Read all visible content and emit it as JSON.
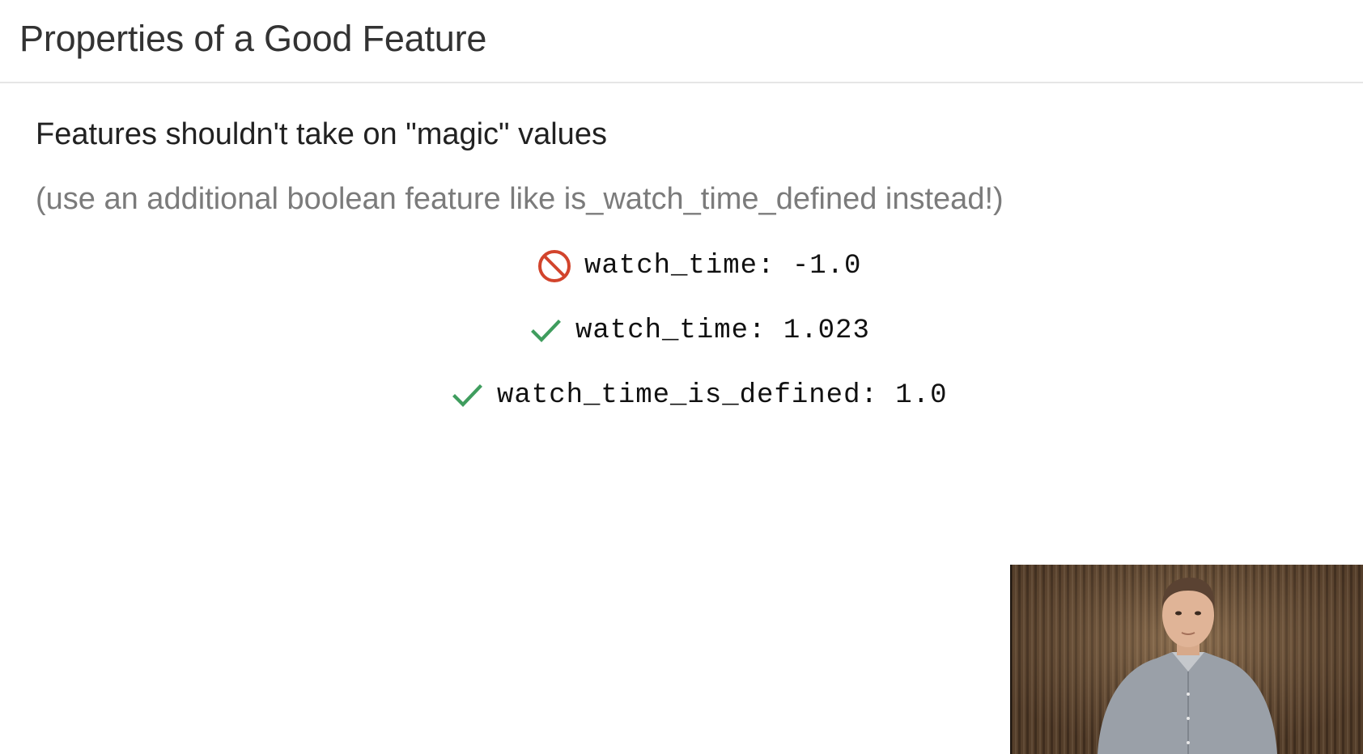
{
  "slide": {
    "title": "Properties of a Good Feature",
    "heading": "Features shouldn't take on \"magic\" values",
    "note": "(use an additional boolean feature like is_watch_time_defined instead!)",
    "examples": [
      {
        "status": "bad",
        "icon": "prohibited-icon",
        "text": "watch_time: -1.0"
      },
      {
        "status": "good",
        "icon": "checkmark-icon",
        "text": "watch_time: 1.023"
      },
      {
        "status": "good",
        "icon": "checkmark-icon",
        "text": "watch_time_is_defined: 1.0"
      }
    ]
  },
  "colors": {
    "bad": "#d2442c",
    "good": "#3f9d5e",
    "note": "#7b7b7b"
  },
  "video": {
    "description_icon": "presenter-video"
  }
}
